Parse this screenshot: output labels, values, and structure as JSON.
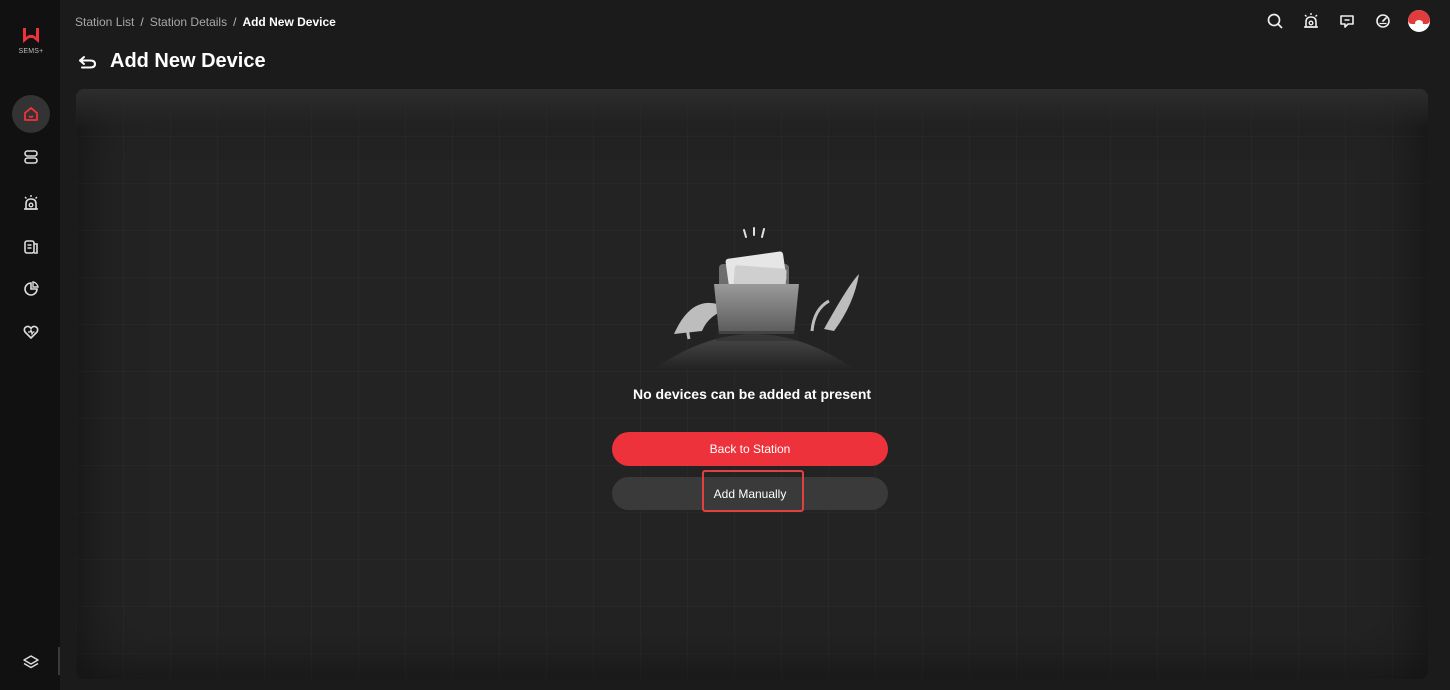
{
  "app": {
    "brand": "SEMS+",
    "accent_color": "#ee323b"
  },
  "breadcrumb": [
    "Station List",
    "Station Details",
    "Add New Device"
  ],
  "page": {
    "title": "Add New Device",
    "back_icon": "back-arrow-icon"
  },
  "header_icons": [
    "search-icon",
    "alarm-icon",
    "message-icon",
    "speed-icon",
    "avatar"
  ],
  "sidebar": {
    "items": [
      {
        "icon": "home-icon",
        "active": true
      },
      {
        "icon": "device-list-icon",
        "active": false
      },
      {
        "icon": "alarm-icon",
        "active": false
      },
      {
        "icon": "report-icon",
        "active": false
      },
      {
        "icon": "analytics-icon",
        "active": false
      },
      {
        "icon": "favorites-icon",
        "active": false
      }
    ],
    "bottom_icon": "layers-icon"
  },
  "empty_state": {
    "message": "No devices can be added at present",
    "primary_button": "Back to Station",
    "secondary_button": "Add Manually"
  }
}
